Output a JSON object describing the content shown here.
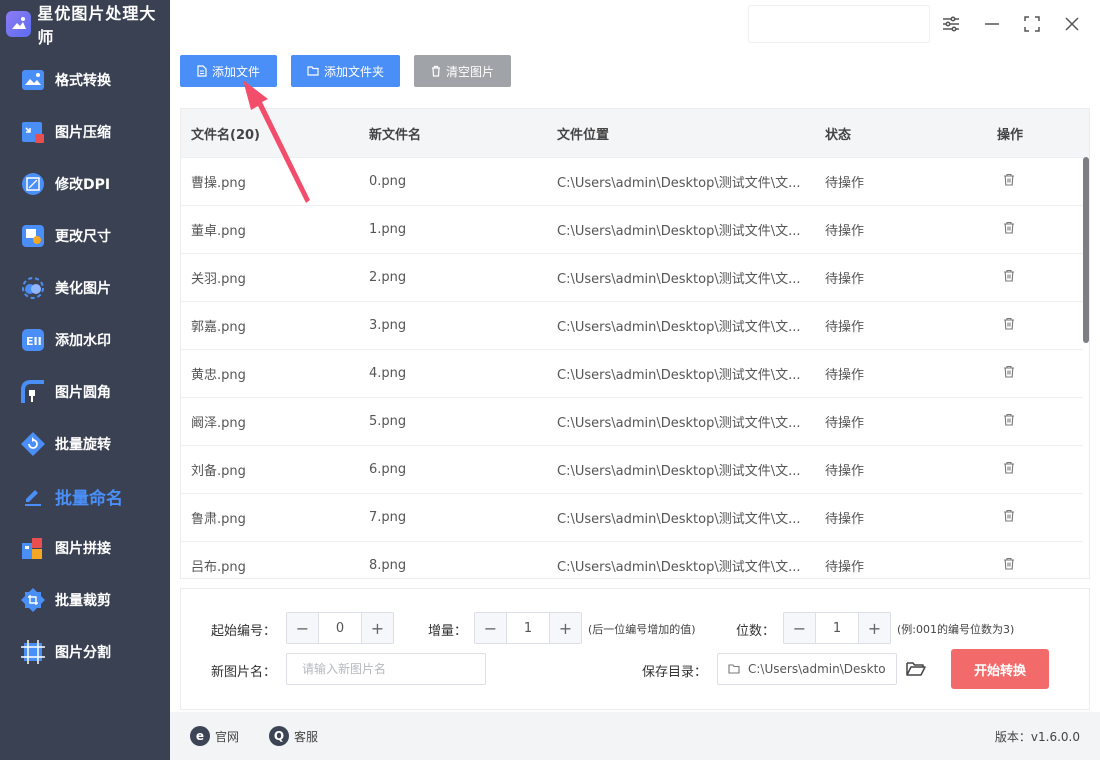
{
  "app": {
    "title": "星优图片处理大师"
  },
  "sidebar": {
    "items": [
      {
        "label": "格式转换",
        "icon": "image-format-icon",
        "active": false
      },
      {
        "label": "图片压缩",
        "icon": "image-compress-icon",
        "active": false
      },
      {
        "label": "修改DPI",
        "icon": "dpi-icon",
        "active": false
      },
      {
        "label": "更改尺寸",
        "icon": "resize-icon",
        "active": false
      },
      {
        "label": "美化图片",
        "icon": "beautify-icon",
        "active": false
      },
      {
        "label": "添加水印",
        "icon": "watermark-icon",
        "active": false
      },
      {
        "label": "图片圆角",
        "icon": "rounded-corner-icon",
        "active": false
      },
      {
        "label": "批量旋转",
        "icon": "rotate-icon",
        "active": false
      },
      {
        "label": "批量命名",
        "icon": "rename-icon",
        "active": true
      },
      {
        "label": "图片拼接",
        "icon": "stitch-icon",
        "active": false
      },
      {
        "label": "批量裁剪",
        "icon": "crop-icon",
        "active": false
      },
      {
        "label": "图片分割",
        "icon": "split-icon",
        "active": false
      }
    ]
  },
  "toolbar": {
    "add_file": "添加文件",
    "add_folder": "添加文件夹",
    "clear_images": "清空图片"
  },
  "table": {
    "headers": [
      "文件名(20)",
      "新文件名",
      "文件位置",
      "状态",
      "操作"
    ],
    "rows": [
      {
        "name": "曹操.png",
        "new_name": "0.png",
        "path": "C:\\Users\\admin\\Desktop\\测试文件\\文...",
        "status": "待操作"
      },
      {
        "name": "董卓.png",
        "new_name": "1.png",
        "path": "C:\\Users\\admin\\Desktop\\测试文件\\文...",
        "status": "待操作"
      },
      {
        "name": "关羽.png",
        "new_name": "2.png",
        "path": "C:\\Users\\admin\\Desktop\\测试文件\\文...",
        "status": "待操作"
      },
      {
        "name": "郭嘉.png",
        "new_name": "3.png",
        "path": "C:\\Users\\admin\\Desktop\\测试文件\\文...",
        "status": "待操作"
      },
      {
        "name": "黄忠.png",
        "new_name": "4.png",
        "path": "C:\\Users\\admin\\Desktop\\测试文件\\文...",
        "status": "待操作"
      },
      {
        "name": "阚泽.png",
        "new_name": "5.png",
        "path": "C:\\Users\\admin\\Desktop\\测试文件\\文...",
        "status": "待操作"
      },
      {
        "name": "刘备.png",
        "new_name": "6.png",
        "path": "C:\\Users\\admin\\Desktop\\测试文件\\文...",
        "status": "待操作"
      },
      {
        "name": "鲁肃.png",
        "new_name": "7.png",
        "path": "C:\\Users\\admin\\Desktop\\测试文件\\文...",
        "status": "待操作"
      },
      {
        "name": "吕布.png",
        "new_name": "8.png",
        "path": "C:\\Users\\admin\\Desktop\\测试文件\\文...",
        "status": "待操作"
      }
    ]
  },
  "settings": {
    "start_number_label": "起始编号：",
    "start_number_value": "0",
    "increment_label": "增量：",
    "increment_value": "1",
    "increment_hint": "(后一位编号增加的值)",
    "digits_label": "位数：",
    "digits_value": "1",
    "digits_hint": "(例:001的编号位数为3)",
    "new_name_label": "新图片名：",
    "new_name_placeholder": "请输入新图片名",
    "save_dir_label": "保存目录：",
    "save_dir_value": "C:\\Users\\admin\\Deskto",
    "start_button": "开始转换"
  },
  "footer": {
    "website": "官网",
    "support": "客服",
    "version": "版本：v1.6.0.0"
  },
  "colors": {
    "accent": "#4a8ef7",
    "sidebar_bg": "#3a4152",
    "start_button": "#f26a6a",
    "arrow": "#f24d6b"
  }
}
